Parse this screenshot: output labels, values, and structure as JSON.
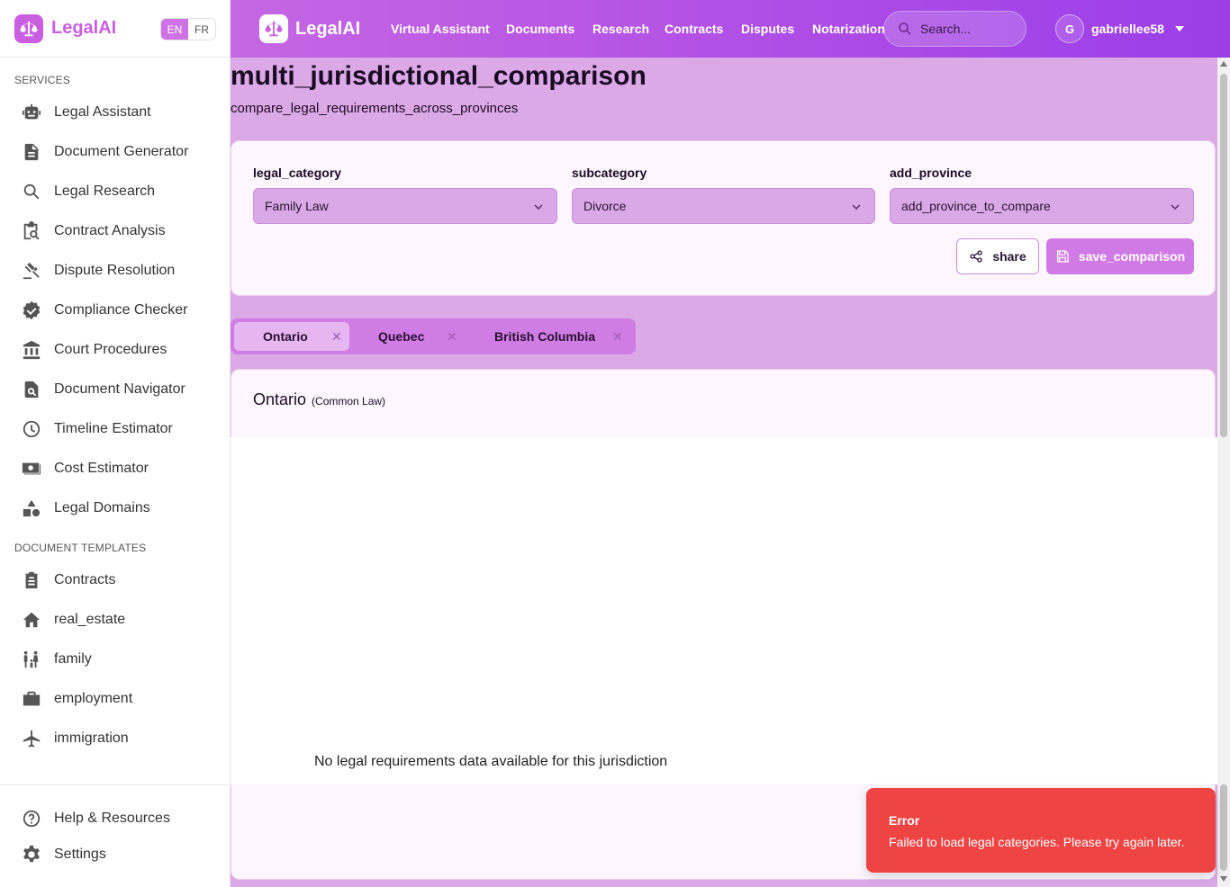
{
  "app": {
    "brand": "LegalAI"
  },
  "lang": {
    "en": "EN",
    "fr": "FR"
  },
  "sidebar": {
    "section_services": "SERVICES",
    "services": [
      {
        "label": "Legal Assistant",
        "icon": "robot-icon"
      },
      {
        "label": "Document Generator",
        "icon": "document-icon"
      },
      {
        "label": "Legal Research",
        "icon": "search-icon"
      },
      {
        "label": "Contract Analysis",
        "icon": "contract-search-icon"
      },
      {
        "label": "Dispute Resolution",
        "icon": "gavel-icon"
      },
      {
        "label": "Compliance Checker",
        "icon": "verified-badge-icon"
      },
      {
        "label": "Court Procedures",
        "icon": "courthouse-icon"
      },
      {
        "label": "Document Navigator",
        "icon": "document-search-icon"
      },
      {
        "label": "Timeline Estimator",
        "icon": "clock-icon"
      },
      {
        "label": "Cost Estimator",
        "icon": "money-icon"
      },
      {
        "label": "Legal Domains",
        "icon": "shapes-icon"
      }
    ],
    "section_templates": "DOCUMENT TEMPLATES",
    "templates": [
      {
        "label": "Contracts",
        "icon": "clipboard-icon"
      },
      {
        "label": "real_estate",
        "icon": "home-icon"
      },
      {
        "label": "family",
        "icon": "family-icon"
      },
      {
        "label": "employment",
        "icon": "briefcase-icon"
      },
      {
        "label": "immigration",
        "icon": "airplane-icon"
      }
    ],
    "footer": [
      {
        "label": "Help & Resources",
        "icon": "help-icon"
      },
      {
        "label": "Settings",
        "icon": "gear-icon"
      }
    ]
  },
  "topnav": {
    "items": [
      "Virtual Assistant",
      "Documents",
      "Research",
      "Contracts",
      "Disputes",
      "Notarization"
    ],
    "search_placeholder": "Search...",
    "user_initial": "G",
    "username": "gabriellee58"
  },
  "page": {
    "title": "multi_jurisdictional_comparison",
    "subtitle": "compare_legal_requirements_across_provinces"
  },
  "filters": {
    "legal_category_label": "legal_category",
    "legal_category_value": "Family Law",
    "subcategory_label": "subcategory",
    "subcategory_value": "Divorce",
    "add_province_label": "add_province",
    "add_province_value": "add_province_to_compare",
    "share_label": "share",
    "save_label": "save_comparison"
  },
  "tabs": [
    {
      "label": "Ontario",
      "active": true
    },
    {
      "label": "Quebec",
      "active": false
    },
    {
      "label": "British Columbia",
      "active": false
    }
  ],
  "jurisdiction": {
    "name": "Ontario",
    "type": "(Common Law)",
    "no_data": "No legal requirements data available for this jurisdiction"
  },
  "toast": {
    "title": "Error",
    "message": "Failed to load legal categories. Please try again later."
  },
  "colors": {
    "accent": "#c95fe0",
    "topbar_start": "#c667e3",
    "topbar_end": "#9a3ee8",
    "main_bg": "#dba9e6",
    "error": "#ef4444"
  }
}
